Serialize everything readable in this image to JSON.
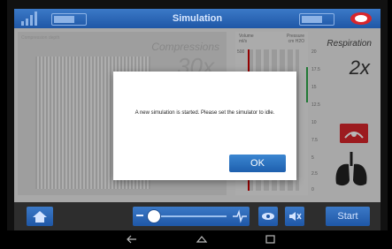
{
  "header": {
    "title": "Simulation"
  },
  "compressions": {
    "title": "Compressions",
    "value": "30x",
    "axis_label": "Compression depth"
  },
  "volume": {
    "label_line1": "Volume",
    "label_line2": "ml/s",
    "top_tick": "500"
  },
  "pressure": {
    "label_line1": "Pressure",
    "label_line2": "cm H2O",
    "ticks": [
      "20",
      "17.5",
      "15",
      "12.5",
      "10",
      "7.5",
      "5",
      "2.5",
      "0"
    ]
  },
  "respiration": {
    "title": "Respiration",
    "value": "2x"
  },
  "dialog": {
    "message": "A new simulation is started. Please set the simulator to idle.",
    "ok_label": "OK"
  },
  "controls": {
    "start_label": "Start"
  },
  "icons": {
    "home": "home-icon",
    "signal": "signal-strength-icon",
    "battery": "battery-icon",
    "logo": "brand-logo-icon",
    "eye": "eye-icon",
    "mute": "mute-icon",
    "pulse": "pulse-icon",
    "airway": "airway-icon",
    "lungs": "lungs-icon",
    "nav_back": "back-icon",
    "nav_home": "home-nav-icon",
    "nav_recent": "recent-apps-icon"
  },
  "colors": {
    "accent": "#1f57a6",
    "alert": "#d8262c",
    "ok": "#2ea84a"
  }
}
